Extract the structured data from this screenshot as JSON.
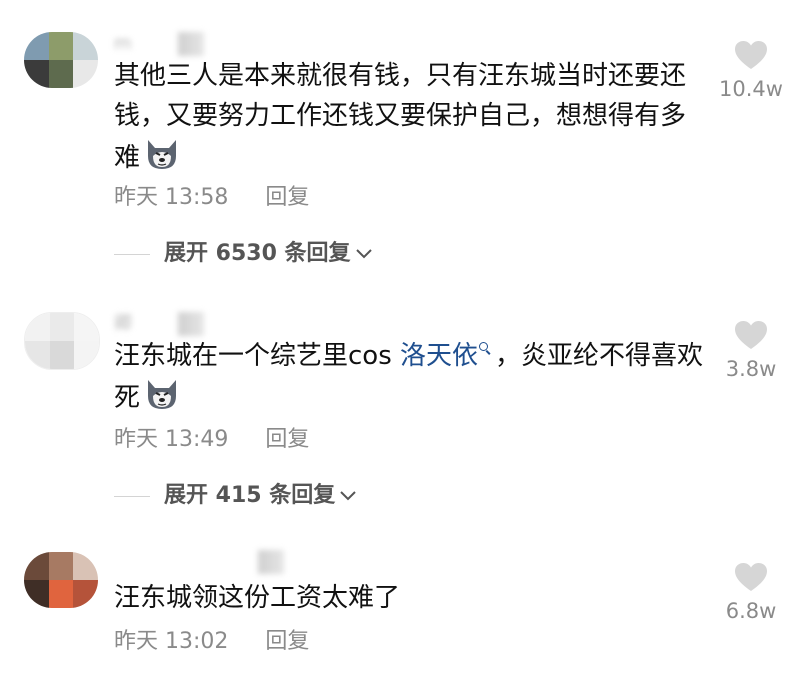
{
  "comments": [
    {
      "avatar_colors": [
        "#7f9bb0",
        "#8d9c6a",
        "#c9d4d8",
        "#3b3b3b",
        "#5e6b4e",
        "#e8e8e8"
      ],
      "username": "m",
      "segments_before_link": "其他三人是本来就很有钱，只有汪东城当时还要还钱，又要努力工作还钱又要保护自己，想想得有多难",
      "time": "昨天 13:58",
      "reply": "回复",
      "expand": "展开 6530 条回复",
      "likes": "10.4w"
    },
    {
      "avatar_colors": [
        "#f2f2f2",
        "#eaeaea",
        "#f5f5f5",
        "#e6e6e6",
        "#d9d9d9",
        "#f4f4f4"
      ],
      "username": "卿",
      "text_before": "汪东城在一个综艺里cos ",
      "link": "洛天依",
      "text_after": "，炎亚纶不得喜欢死",
      "time": "昨天 13:49",
      "reply": "回复",
      "expand": "展开 415 条回复",
      "likes": "3.8w"
    },
    {
      "avatar_colors": [
        "#6b4a3a",
        "#a77a63",
        "#d9c2b5",
        "#3f2e26",
        "#e0643e",
        "#b5533a"
      ],
      "username": "",
      "text": "汪东城领这份工资太难了",
      "time": "昨天 13:02",
      "reply": "回复",
      "likes": "6.8w"
    }
  ]
}
